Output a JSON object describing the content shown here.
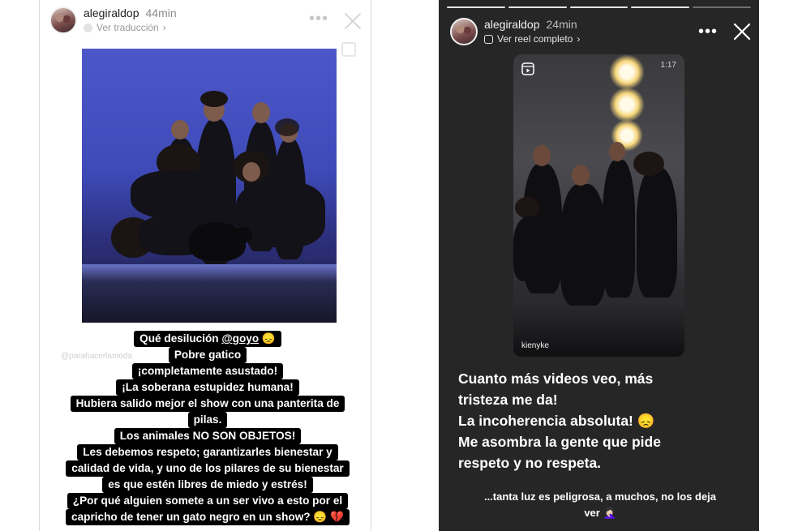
{
  "left_story": {
    "username": "alegiraldop",
    "time": "44min",
    "subtitle": "Ver traducción",
    "more_label": "•••",
    "watermark": "@parahacerlamoda",
    "caption_lines": [
      [
        "Qué desilución ",
        "@goyo",
        " 😞"
      ],
      "Pobre gatico",
      "¡completamente asustado!",
      "¡La soberana estupidez humana!",
      "Hubiera salido mejor el show con una panterita de",
      "pilas.",
      "Los animales NO SON OBJETOS!",
      "Les debemos respeto; garantizarles bienestar y",
      "calidad de vida, y uno de los pilares de su bienestar",
      "es que estén libres de miedo y estrés!",
      "¿Por qué alguien somete a un ser vivo a esto por el",
      "capricho de tener un gato negro en un show? 😞 💔"
    ]
  },
  "right_story": {
    "username": "alegiraldop",
    "time": "24min",
    "subtitle": "Ver reel completo",
    "more_label": "•••",
    "progress_segments": 5,
    "progress_done": 4,
    "video": {
      "duration": "1:17",
      "credit": "kienyke"
    },
    "text_lines": [
      "Cuanto más videos veo, más",
      "tristeza me da!",
      "La incoherencia absoluta! 😞",
      "Me asombra la gente que pide",
      "respeto y no respeta."
    ],
    "footer_line1": "...tanta luz es peligrosa, a muchos, no los deja",
    "footer_line2": "ver 🤦🏻‍♀️"
  },
  "colors": {
    "left_bg": "#ffffff",
    "right_bg": "#262626",
    "caption_bg": "#000000",
    "text_light": "#ffffff"
  }
}
